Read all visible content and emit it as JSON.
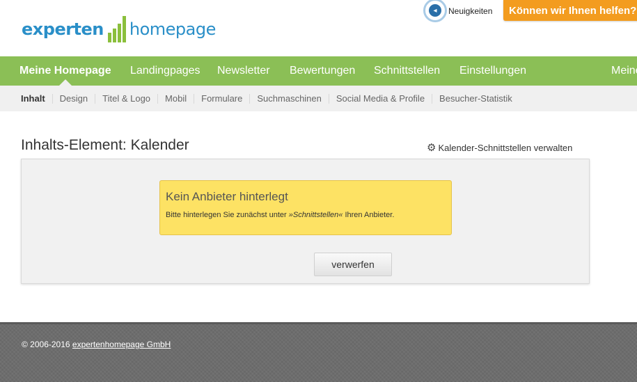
{
  "logo": {
    "part1": "experten",
    "part2": "homepage"
  },
  "header": {
    "news_label": "Neuigkeiten",
    "help_button": "Können wir Ihnen helfen?"
  },
  "mainnav": {
    "items": [
      {
        "label": "Meine Homepage",
        "active": true
      },
      {
        "label": "Landingpages"
      },
      {
        "label": "Newsletter"
      },
      {
        "label": "Bewertungen"
      },
      {
        "label": "Schnittstellen"
      },
      {
        "label": "Einstellungen"
      },
      {
        "label": "Meine"
      }
    ]
  },
  "subnav": {
    "items": [
      {
        "label": "Inhalt",
        "active": true
      },
      {
        "label": "Design"
      },
      {
        "label": "Titel & Logo"
      },
      {
        "label": "Mobil"
      },
      {
        "label": "Formulare"
      },
      {
        "label": "Suchmaschinen"
      },
      {
        "label": "Social Media & Profile"
      },
      {
        "label": "Besucher-Statistik"
      }
    ]
  },
  "content": {
    "title": "Inhalts-Element: Kalender",
    "manage_link": "Kalender-Schnittstellen verwalten",
    "notice_title": "Kein Anbieter hinterlegt",
    "notice_text_before": "Bitte hinterlegen Sie zunächst unter ",
    "notice_text_link": "»Schnittstellen«",
    "notice_text_after": " Ihren Anbieter.",
    "discard_button": "verwerfen"
  },
  "footer": {
    "copyright": "© 2006-2016 ",
    "company": "expertenhomepage GmbH"
  },
  "colors": {
    "brand_blue": "#2a8fc8",
    "nav_green": "#8bbf56",
    "help_orange": "#f39c1f",
    "notice_yellow": "#fde264"
  }
}
